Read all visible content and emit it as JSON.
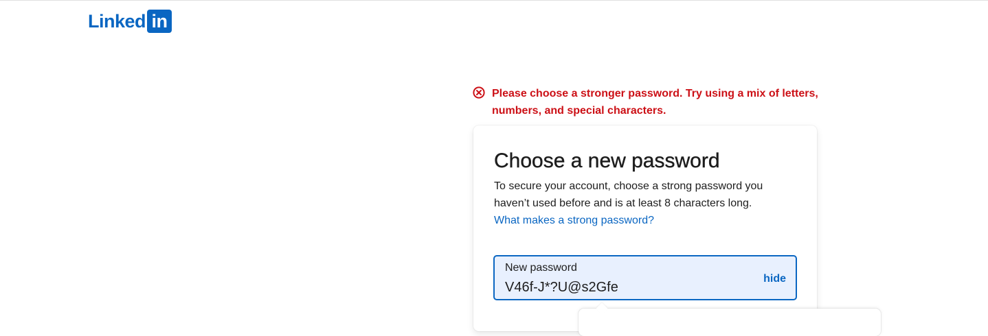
{
  "header": {
    "logo_text": "Linked",
    "logo_box_text": "in"
  },
  "error": {
    "icon": "error-circle-x-icon",
    "message": "Please choose a stronger password. Try using a mix of letters, numbers, and special characters.",
    "color": "#cc1016"
  },
  "form": {
    "title": "Choose a new password",
    "description": "To secure your account, choose a strong password you haven’t used before and is at least 8 characters long.",
    "help_link": "What makes a strong password?",
    "password_field": {
      "label": "New password",
      "value": "V46f-J*?U@s2Gfe",
      "toggle_label": "hide"
    }
  },
  "colors": {
    "brand": "#0a66c2",
    "field_background": "#e8f0fe"
  }
}
